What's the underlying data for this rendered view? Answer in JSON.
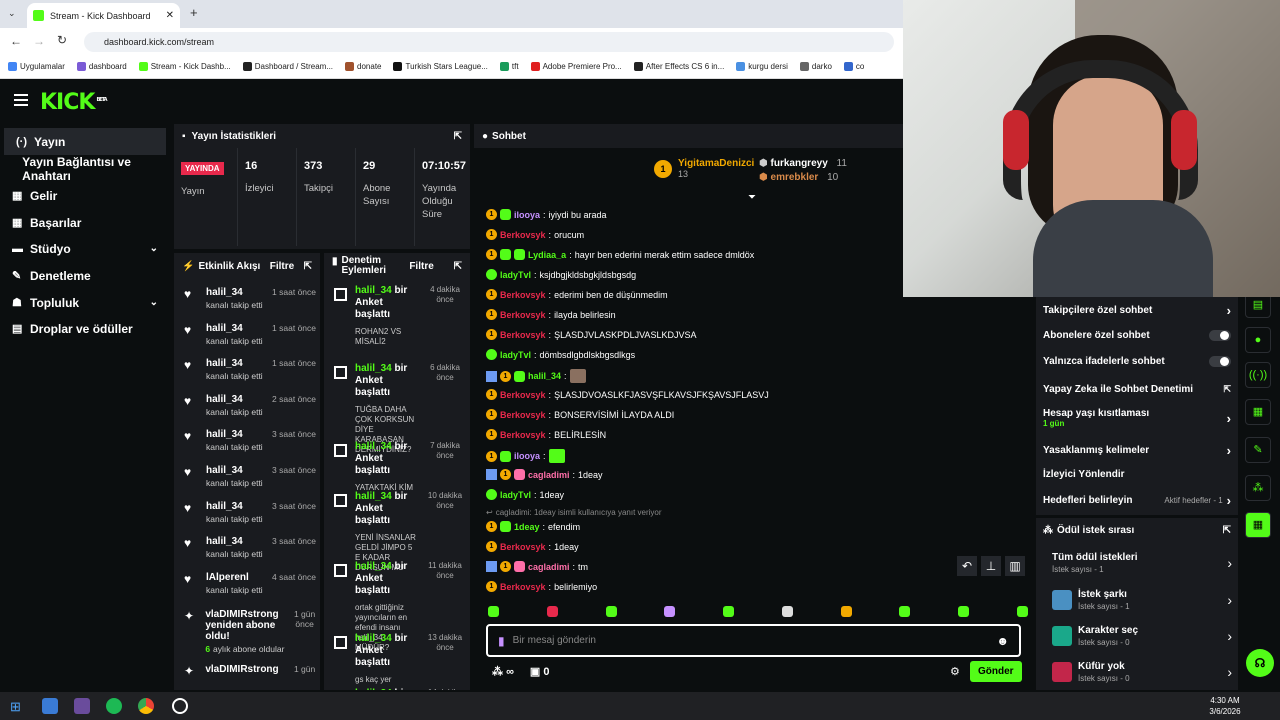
{
  "browser": {
    "tab_title": "Stream - Kick Dashboard",
    "url": "dashboard.kick.com/stream",
    "bookmarks": [
      "Uygulamalar",
      "dashboard",
      "Stream - Kick Dashb...",
      "Dashboard / Stream...",
      "donate",
      "Turkish Stars League...",
      "tft",
      "Adobe Premiere Pro...",
      "After Effects CS 6 in...",
      "kurgu dersi",
      "darko",
      "co"
    ]
  },
  "logo": {
    "text": "KICK",
    "beta": "BETA"
  },
  "sidebar": {
    "items": [
      {
        "label": "Yayın",
        "icon": "broadcast-icon",
        "active": true
      },
      {
        "label": "Yayın Bağlantısı ve Anahtarı",
        "icon": ""
      },
      {
        "label": "Gelir",
        "icon": "money-icon"
      },
      {
        "label": "Başarılar",
        "icon": "grid-icon"
      },
      {
        "label": "Stüdyo",
        "icon": "studio-icon",
        "chevron": true
      },
      {
        "label": "Denetleme",
        "icon": "wrench-icon"
      },
      {
        "label": "Topluluk",
        "icon": "people-icon",
        "chevron": true
      },
      {
        "label": "Droplar ve ödüller",
        "icon": "gift-icon"
      }
    ]
  },
  "stats": {
    "title": "Yayın İstatistikleri",
    "live_badge": "YAYINDA",
    "live_label": "Yayın",
    "items": [
      {
        "value": "16",
        "label": "İzleyici"
      },
      {
        "value": "373",
        "label": "Takipçi"
      },
      {
        "value": "29",
        "label": "Abone Sayısı"
      },
      {
        "value": "07:10:57",
        "label": "Yayında Olduğu Süre"
      }
    ]
  },
  "activity": {
    "title": "Etkinlik Akışı",
    "filter": "Filtre",
    "items": [
      {
        "name": "halil_34",
        "sub": "kanalı takip etti",
        "time": "1 saat önce"
      },
      {
        "name": "halil_34",
        "sub": "kanalı takip etti",
        "time": "1 saat önce"
      },
      {
        "name": "halil_34",
        "sub": "kanalı takip etti",
        "time": "1 saat önce"
      },
      {
        "name": "halil_34",
        "sub": "kanalı takip etti",
        "time": "2 saat önce"
      },
      {
        "name": "halil_34",
        "sub": "kanalı takip etti",
        "time": "3 saat önce"
      },
      {
        "name": "halil_34",
        "sub": "kanalı takip etti",
        "time": "3 saat önce"
      },
      {
        "name": "halil_34",
        "sub": "kanalı takip etti",
        "time": "3 saat önce"
      },
      {
        "name": "halil_34",
        "sub": "kanalı takip etti",
        "time": "3 saat önce"
      },
      {
        "name": "lAlperenl",
        "sub": "kanalı takip etti",
        "time": "4 saat önce"
      }
    ],
    "sub_items": [
      {
        "name": "vlaDIMIRstrong yeniden abone oldu!",
        "sub_prefix": "6",
        "sub": "aylık abone oldular",
        "time": "1 gün önce"
      },
      {
        "name": "vlaDIMIRstrong",
        "time": "1 gün"
      }
    ]
  },
  "moderation": {
    "title": "Denetim Eylemleri",
    "filter": "Filtre",
    "items": [
      {
        "user": "halil_34",
        "action": "bir Anket başlattı",
        "desc": "ROHAN2 VS MİSALİ2",
        "time": "4 dakika önce"
      },
      {
        "user": "halil_34",
        "action": "bir Anket başlattı",
        "desc": "TUĞBA DAHA ÇOK KORKSUN DİYE KARABASAN DERMİYDİNİZ?",
        "time": "6 dakika önce"
      },
      {
        "user": "halil_34",
        "action": "bir Anket başlattı",
        "desc": "YATAKTAKİ KİM",
        "time": "7 dakika önce"
      },
      {
        "user": "halil_34",
        "action": "bir Anket başlattı",
        "desc": "YENİ İNSANLAR GELDİ JİMPO 5 E KADAR DURSUN MU",
        "time": "10 dakika önce"
      },
      {
        "user": "halil_34",
        "action": "bir Anket başlattı",
        "desc": "ortak gittiğiniz yayıncıların en efendi insanı halil_34 MÜDÜR?",
        "time": "11 dakika önce"
      },
      {
        "user": "halil_34",
        "action": "bir Anket başlattı",
        "desc": "gs kaç yer",
        "time": "13 dakika önce"
      },
      {
        "user": "halil_34",
        "action": "bir Anket başlattı",
        "desc": "",
        "time": "14 dakika önce"
      }
    ]
  },
  "chat": {
    "title": "Sohbet",
    "top_gifters": [
      {
        "name": "YigitamaDenizci",
        "count": "13"
      },
      {
        "name": "furkangreyy",
        "count": "11"
      },
      {
        "name": "emrebkler",
        "count": "10"
      }
    ],
    "messages": [
      {
        "user": "ilooya",
        "color": "#c691ff",
        "text": "iyiydi bu arada",
        "badges": "1g"
      },
      {
        "user": "Berkovsyk",
        "color": "#e8294c",
        "text": "orucum",
        "badges": "1"
      },
      {
        "user": "Lydiaa_a",
        "color": "#53fc18",
        "text": "hayır ben ederini merak ettim sadece dmldöx",
        "badges": "1gg"
      },
      {
        "user": "ladyTvl",
        "color": "#53fc18",
        "text": "ksjdbgjkldsbgkjldsbgsdg",
        "badges": "v"
      },
      {
        "user": "Berkovsyk",
        "color": "#e8294c",
        "text": "ederimi ben de düşünmedim",
        "badges": "1"
      },
      {
        "user": "Berkovsyk",
        "color": "#e8294c",
        "text": "ilayda belirlesin",
        "badges": "1"
      },
      {
        "user": "Berkovsyk",
        "color": "#e8294c",
        "text": "ŞLASDJVLASKPDLJVASLKDJVSA",
        "badges": "1"
      },
      {
        "user": "ladyTvl",
        "color": "#53fc18",
        "text": "dömbsdlgbdlskbgsdlkgs",
        "badges": "v"
      },
      {
        "user": "halil_34",
        "color": "#53fc18",
        "text": "",
        "badges": "b1g",
        "emote": true
      },
      {
        "user": "Berkovsyk",
        "color": "#e8294c",
        "text": "ŞLASJDVOASLKFJASVŞFLKAVSJFKŞAVSJFLASVJ",
        "badges": "1"
      },
      {
        "user": "Berkovsyk",
        "color": "#e8294c",
        "text": "BONSERVİSİMİ İLAYDA ALDI",
        "badges": "1"
      },
      {
        "user": "Berkovsyk",
        "color": "#e8294c",
        "text": "BELİRLESİN",
        "badges": "1"
      },
      {
        "user": "ilooya",
        "color": "#c691ff",
        "text": "",
        "badges": "1g",
        "emote": true
      },
      {
        "user": "cagladimi",
        "color": "#ff6fa9",
        "text": "1deay",
        "badges": "b1p"
      },
      {
        "user": "ladyTvl",
        "color": "#53fc18",
        "text": "1deay",
        "badges": "v"
      },
      {
        "user": "1deay",
        "color": "#53fc18",
        "text": "efendim",
        "badges": "1g",
        "reply": "cagladimi: 1deay isimli kullanıcıya yanıt veriyor"
      },
      {
        "user": "Berkovsyk",
        "color": "#e8294c",
        "text": "1deay",
        "badges": "1"
      },
      {
        "user": "cagladimi",
        "color": "#ff6fa9",
        "text": "tm",
        "badges": "b1p"
      },
      {
        "user": "Berkovsyk",
        "color": "#e8294c",
        "text": "belirlemiyo",
        "badges": "1"
      }
    ],
    "input_placeholder": "Bir mesaj gönderin",
    "points": "∞",
    "gift_count": "0",
    "send_label": "Gönder"
  },
  "chat_settings": {
    "items": [
      {
        "label": "Takipçilere özel sohbet",
        "type": "chevron"
      },
      {
        "label": "Abonelere özel sohbet",
        "type": "toggle"
      },
      {
        "label": "Yalnızca ifadelerle sohbet",
        "type": "toggle"
      },
      {
        "label": "Yapay Zeka ile Sohbet Denetimi",
        "type": "link"
      },
      {
        "label": "Hesap yaşı kısıtlaması",
        "sub": "1 gün",
        "type": "chevron"
      },
      {
        "label": "Yasaklanmış kelimeler",
        "type": "chevron"
      },
      {
        "label": "İzleyici Yönlendir",
        "type": "none"
      },
      {
        "label": "Hedefleri belirleyin",
        "extra": "Aktif hedefler - 1",
        "type": "chevron"
      }
    ]
  },
  "rewards": {
    "title": "Ödül istek sırası",
    "items": [
      {
        "label": "Tüm ödül istekleri",
        "sub": "İstek sayısı - 1",
        "color": ""
      },
      {
        "label": "İstek şarkı",
        "sub": "İstek sayısı - 1",
        "color": "#4a90c2"
      },
      {
        "label": "Karakter seç",
        "sub": "İstek sayısı - 0",
        "color": "#1aa88a"
      },
      {
        "label": "Küfür yok",
        "sub": "İstek sayısı - 0",
        "color": "#c2264a"
      }
    ]
  },
  "taskbar": {
    "time": "4:30 AM",
    "date": "3/6/2026"
  }
}
